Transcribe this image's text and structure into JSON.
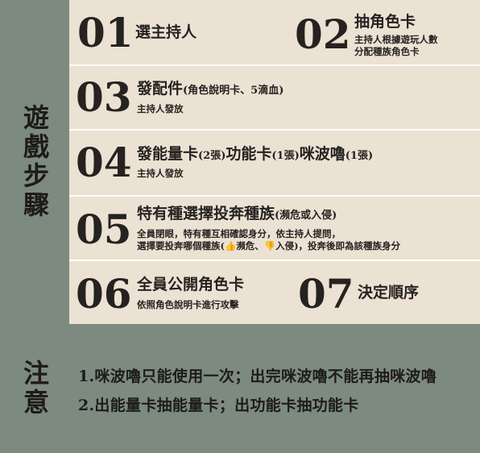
{
  "sections": {
    "steps_label": "遊戲步驟",
    "notes_label": "注意"
  },
  "steps": [
    {
      "num": "01",
      "title": "選主持人",
      "desc": []
    },
    {
      "num": "02",
      "title": "抽角色卡",
      "desc": [
        "主持人根據遊玩人數",
        "分配種族角色卡"
      ]
    },
    {
      "num": "03",
      "title": "發配件",
      "title_note": "(角色說明卡、5滴血)",
      "desc": [
        "主持人發放"
      ]
    },
    {
      "num": "04",
      "title_parts": [
        "發能量卡",
        "(2張)",
        "功能卡",
        "(1張)",
        "咪波嚕",
        "(1張)"
      ],
      "desc": [
        "主持人發放"
      ]
    },
    {
      "num": "05",
      "title": "特有種選擇投奔種族",
      "title_note": "(瀕危或入侵)",
      "desc": [
        "全員閉眼，特有種互相確認身分，依主持人提問，",
        "選擇要投奔哪個種族(👍瀕危、👎入侵)，投奔後即為該種族身分"
      ]
    },
    {
      "num": "06",
      "title": "全員公開角色卡",
      "desc": [
        "依照角色說明卡進行攻擊"
      ]
    },
    {
      "num": "07",
      "title": "決定順序",
      "desc": []
    }
  ],
  "notes": [
    "1.咪波嚕只能使用一次；出完咪波嚕不能再抽咪波嚕",
    "2.出能量卡抽能量卡；出功能卡抽功能卡"
  ],
  "colors": {
    "label_bg": "#7c8a80",
    "steps_bg": "#ebe2d4",
    "text": "#262220"
  }
}
